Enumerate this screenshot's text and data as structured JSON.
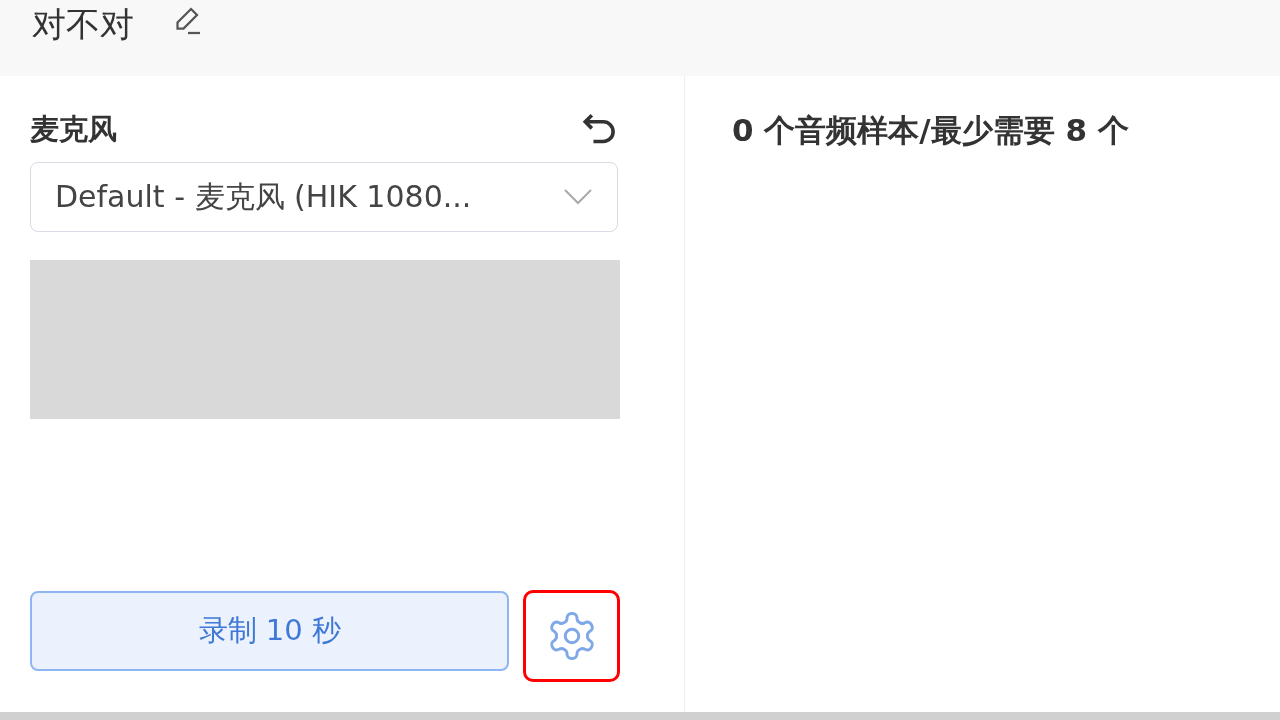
{
  "header": {
    "title": "对不对"
  },
  "microphone": {
    "label": "麦克风",
    "device": "Default - 麦克风 (HIK 1080..."
  },
  "record_button": {
    "label": "录制 10 秒"
  },
  "settings_button": {
    "highlighted": true
  },
  "samples": {
    "status": "0 个音频样本/最少需要 8 个"
  }
}
